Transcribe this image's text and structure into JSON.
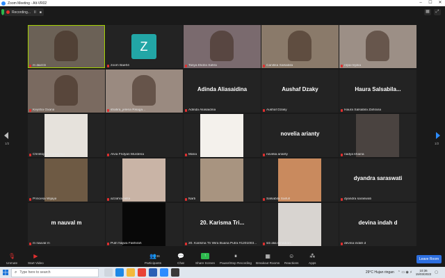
{
  "window": {
    "title": "Zoom Meeting - Alt-VR02"
  },
  "recording": {
    "label": "Recording...",
    "pause": "II",
    "stop": "■"
  },
  "participants": [
    {
      "label": "m diarzzi",
      "big": "",
      "type": "video",
      "bg": "#6b6156"
    },
    {
      "label": "zoom Bae04",
      "big": "",
      "type": "avatar",
      "bg": "#232323"
    },
    {
      "label": "Tasya Elidza Safira",
      "big": "",
      "type": "video",
      "bg": "#7a6a6e"
    },
    {
      "label": "Canitika Salsabila",
      "big": "",
      "type": "video",
      "bg": "#8a7a6a"
    },
    {
      "label": "nrpa-rejolia",
      "big": "",
      "type": "video",
      "bg": "#9c8f86"
    },
    {
      "label": "Keysha Oxana",
      "big": "",
      "type": "video",
      "bg": "#7a6a60"
    },
    {
      "label": "shafira_jelena Rikaga...",
      "big": "",
      "type": "video",
      "bg": "#9a8a80"
    },
    {
      "label": "Adinda Aliasaidina",
      "big": "Adinda Aliasaidina",
      "type": "name",
      "bg": "#232323"
    },
    {
      "label": "Aushaf Dzaky",
      "big": "Aushaf Dzaky",
      "type": "name",
      "bg": "#232323"
    },
    {
      "label": "Haura Salsabila Zahrana",
      "big": "Haura  Salsabila...",
      "type": "name",
      "bg": "#232323"
    },
    {
      "label": "Christoper marpaulan",
      "big": "",
      "type": "photo",
      "bg": "#e6e2dc"
    },
    {
      "label": "Alvia Fridyan Murdena",
      "big": "",
      "type": "blank",
      "bg": "#232323"
    },
    {
      "label": "Maria",
      "big": "",
      "type": "photo",
      "bg": "#f4f1ec"
    },
    {
      "label": "novelia arianty",
      "big": "novelia arianty",
      "type": "name",
      "bg": "#232323"
    },
    {
      "label": "nadya khaina",
      "big": "",
      "type": "photo",
      "bg": "#4a4340"
    },
    {
      "label": "Princesa Wijaya",
      "big": "",
      "type": "photo",
      "bg": "#6e5a44"
    },
    {
      "label": "azzahra lalita",
      "big": "",
      "type": "photo",
      "bg": "#c9b4a6"
    },
    {
      "label": "Narti",
      "big": "",
      "type": "photo",
      "bg": "#a89480"
    },
    {
      "label": "Salsabila Saifull",
      "big": "",
      "type": "photo",
      "bg": "#c98a5e"
    },
    {
      "label": "dyandra saraswati",
      "big": "dyandra saraswati",
      "type": "name",
      "bg": "#232323"
    },
    {
      "label": "m nauval m",
      "big": "m nauval m",
      "type": "name",
      "bg": "#232323"
    },
    {
      "label": "Putri Najwa Fakhirah",
      "big": "",
      "type": "photo",
      "bg": "#080808"
    },
    {
      "label": "20. Karisma Tri Wira Buana Putra #1201003...",
      "big": "20. Karisma Tri...",
      "type": "name",
      "bg": "#232323"
    },
    {
      "label": "siti alia rahadiani",
      "big": "",
      "type": "photo",
      "bg": "#d8d4d0"
    },
    {
      "label": "devina indah d",
      "big": "devina indah d",
      "type": "name",
      "bg": "#232323"
    }
  ],
  "pages": {
    "left": "1/2",
    "right": "1/2"
  },
  "toolbar": {
    "unmute": "Unmute",
    "start_video": "Start Video",
    "participants": "Participants",
    "participants_count": "36",
    "chat": "Chat",
    "share_screen": "Share Screen",
    "pause_recording": "Pause/Stop Recording",
    "breakout": "Breakout Rooms",
    "reactions": "Reactions",
    "apps": "Apps",
    "leave": "Leave Room"
  },
  "taskbar": {
    "search_placeholder": "Type here to search",
    "weather": "29°C  Hujan ringan",
    "time": "10:36",
    "date": "15/03/2022"
  },
  "colors": {
    "accent": "#2d8cff",
    "active_border": "#a3d200",
    "share_green": "#2db84d",
    "mute_red": "#e02f2f"
  }
}
